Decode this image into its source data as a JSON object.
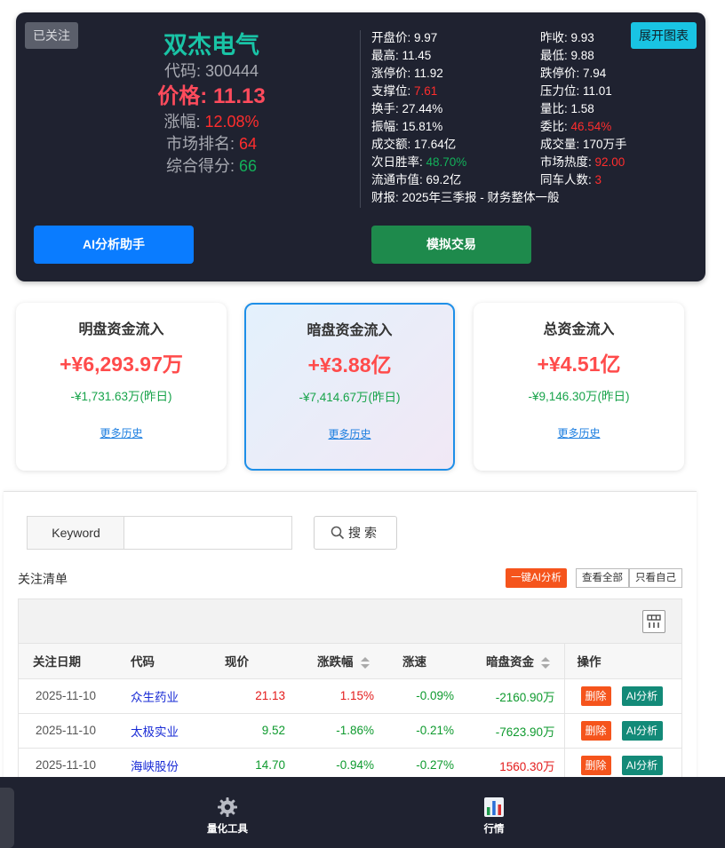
{
  "stock": {
    "follow_label": "已关注",
    "expand_label": "展开图表",
    "name": "双杰电气",
    "code_label": "代码: ",
    "code": "300444",
    "price_label": "价格: ",
    "price": "11.13",
    "change_label": "涨幅: ",
    "change": "12.08%",
    "rank_label": "市场排名: ",
    "rank": "64",
    "score_label": "综合得分: ",
    "score": "66",
    "ai_button": "AI分析助手",
    "sim_button": "模拟交易"
  },
  "metrics": {
    "rows": [
      [
        {
          "label": "开盘价: ",
          "value": "9.97",
          "color": "white"
        },
        {
          "label": "昨收: ",
          "value": "9.93",
          "color": "white"
        }
      ],
      [
        {
          "label": "最高: ",
          "value": "11.45",
          "color": "white"
        },
        {
          "label": "最低: ",
          "value": "9.88",
          "color": "white"
        }
      ],
      [
        {
          "label": "涨停价: ",
          "value": "11.92",
          "color": "white"
        },
        {
          "label": "跌停价: ",
          "value": "7.94",
          "color": "white"
        }
      ],
      [
        {
          "label": "支撑位: ",
          "value": "7.61",
          "color": "red"
        },
        {
          "label": "压力位: ",
          "value": "11.01",
          "color": "white"
        }
      ],
      [
        {
          "label": "换手: ",
          "value": "27.44%",
          "color": "white"
        },
        {
          "label": "量比: ",
          "value": "1.58",
          "color": "white"
        }
      ],
      [
        {
          "label": "振幅: ",
          "value": "15.81%",
          "color": "white"
        },
        {
          "label": "委比: ",
          "value": "46.54%",
          "color": "red"
        }
      ],
      [
        {
          "label": "成交额: ",
          "value": "17.64亿",
          "color": "white"
        },
        {
          "label": "成交量: ",
          "value": "170万手",
          "color": "white"
        }
      ],
      [
        {
          "label": "次日胜率: ",
          "value": "48.70%",
          "color": "green"
        },
        {
          "label": "市场热度: ",
          "value": "92.00",
          "color": "red"
        }
      ],
      [
        {
          "label": "流通市值: ",
          "value": "69.2亿",
          "color": "white"
        },
        {
          "label": "同车人数: ",
          "value": "3",
          "color": "red"
        }
      ]
    ],
    "report": "财报: 2025年三季报 - 财务整体一般"
  },
  "flows": [
    {
      "title": "明盘资金流入",
      "value": "+¥6,293.97万",
      "prev": "-¥1,731.63万(昨日)",
      "link": "更多历史"
    },
    {
      "title": "暗盘资金流入",
      "value": "+¥3.88亿",
      "prev": "-¥7,414.67万(昨日)",
      "link": "更多历史"
    },
    {
      "title": "总资金流入",
      "value": "+¥4.51亿",
      "prev": "-¥9,146.30万(昨日)",
      "link": "更多历史"
    }
  ],
  "search": {
    "label": "Keyword",
    "placeholder": "",
    "button": "搜索"
  },
  "watchlist": {
    "title": "关注清单",
    "ai_all": "一键AI分析",
    "view_all": "查看全部",
    "view_self": "只看自己",
    "headers": [
      "关注日期",
      "代码",
      "现价",
      "涨跌幅",
      "涨速",
      "暗盘资金",
      "操作"
    ],
    "delete_label": "删除",
    "ai_label": "AI分析",
    "rows": [
      {
        "date": "2025-11-10",
        "name": "众生药业",
        "price": "21.13",
        "price_color": "red",
        "change": "1.15%",
        "change_color": "red",
        "speed": "-0.09%",
        "speed_color": "green",
        "dark": "-2160.90万",
        "dark_color": "green"
      },
      {
        "date": "2025-11-10",
        "name": "太极实业",
        "price": "9.52",
        "price_color": "green",
        "change": "-1.86%",
        "change_color": "green",
        "speed": "-0.21%",
        "speed_color": "green",
        "dark": "-7623.90万",
        "dark_color": "green"
      },
      {
        "date": "2025-11-10",
        "name": "海峡股份",
        "price": "14.70",
        "price_color": "green",
        "change": "-0.94%",
        "change_color": "green",
        "speed": "-0.27%",
        "speed_color": "green",
        "dark": "1560.30万",
        "dark_color": "red"
      }
    ]
  },
  "nav": {
    "items": [
      {
        "label": "量化工具",
        "icon": "gear-icon"
      },
      {
        "label": "行情",
        "icon": "chart-icon"
      }
    ]
  },
  "colors": {
    "card_bg": "#1f2230",
    "accent_blue": "#0a7cff",
    "accent_green": "#1e8a4c",
    "up_red": "#ff2d2d",
    "down_green": "#13b05a"
  }
}
